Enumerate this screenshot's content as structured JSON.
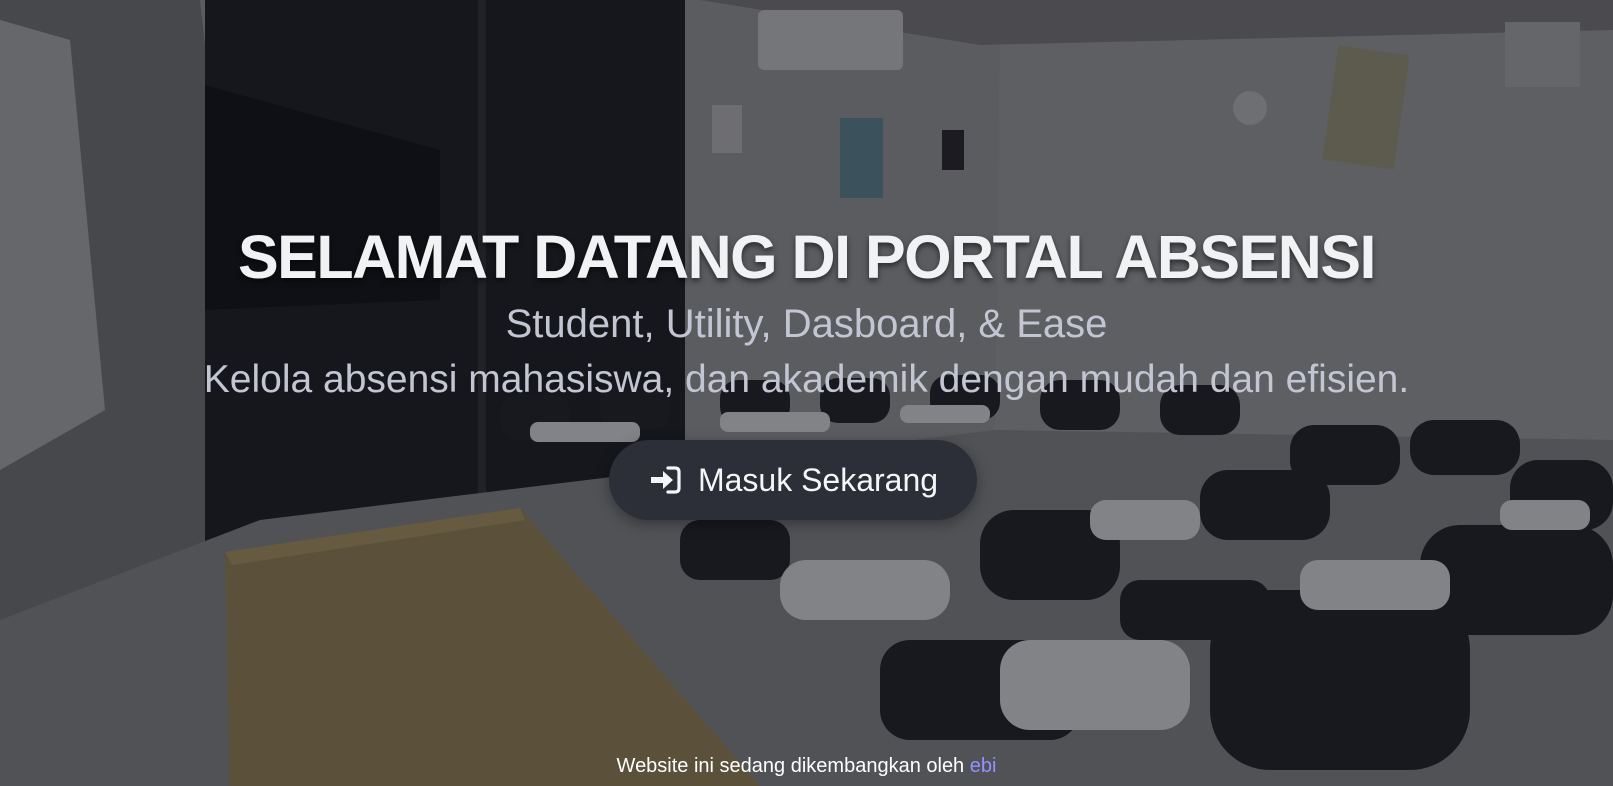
{
  "hero": {
    "title": "SELAMAT DATANG DI PORTAL ABSENSI",
    "subtitle": "Student, Utility, Dasboard, & Ease",
    "description": "Kelola absensi mahasiswa, dan akademik dengan mudah dan efisien.",
    "cta_label": "Masuk Sekarang",
    "cta_icon": "sign-in-icon",
    "background": "classroom-photo"
  },
  "footer": {
    "text": "Website ini sedang dikembangkan oleh",
    "author": "ebi"
  },
  "colors": {
    "title": "#f1f2f4",
    "text": "#c3c6d2",
    "button_bg": "#2c2f38",
    "link": "#8f92ff"
  }
}
